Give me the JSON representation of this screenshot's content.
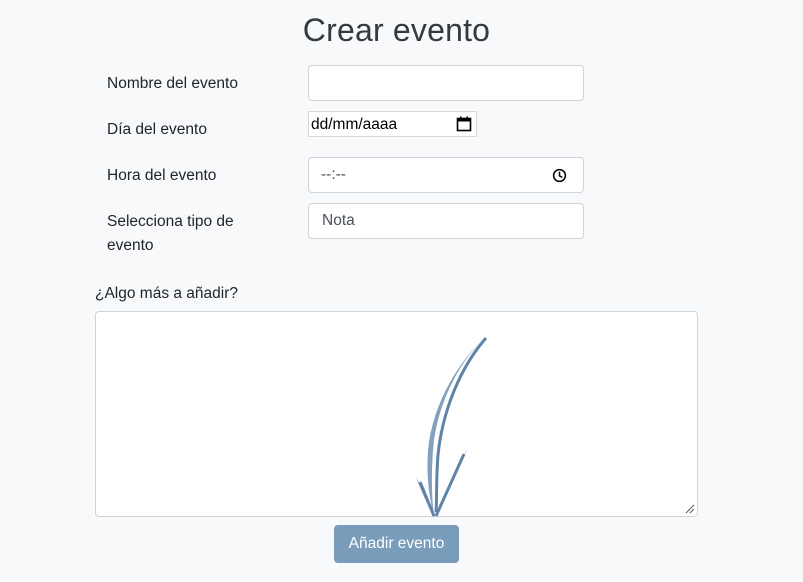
{
  "form": {
    "title": "Crear evento",
    "name_label": "Nombre del evento",
    "name_value": "",
    "day_label": "Día del evento",
    "day_value": "dd/mm/aaaa",
    "time_label": "Hora del evento",
    "time_value": "--:--",
    "type_label": "Selecciona tipo de evento",
    "type_selected": "Nota",
    "extra_label": "¿Algo más a añadir?",
    "extra_value": "",
    "submit_label": "Añadir evento"
  },
  "icons": {
    "date": "calendar-icon",
    "time": "clock-icon",
    "resize": "resize-grip-icon",
    "overlay": "arrow-down-icon"
  },
  "colors": {
    "background": "#f8f9fa",
    "button": "#7a9cbb",
    "arrow": "#6f93b5"
  }
}
